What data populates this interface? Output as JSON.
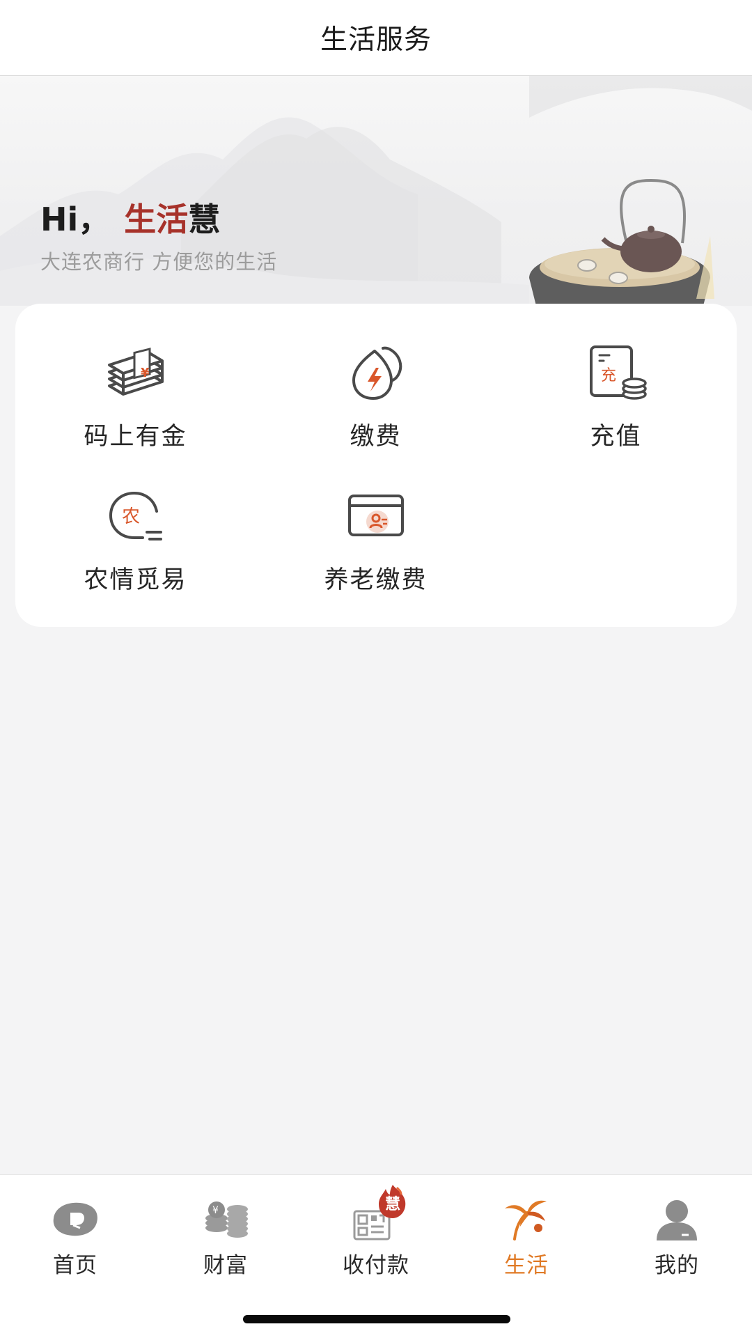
{
  "header": {
    "title": "生活服务"
  },
  "banner": {
    "greeting_prefix": "Hi",
    "greeting_comma": "，",
    "greeting_accent": "生活",
    "greeting_suffix": "慧",
    "subtitle": "大连农商行 方便您的生活"
  },
  "services": [
    {
      "label": "码上有金",
      "icon": "money-stack-icon"
    },
    {
      "label": "缴费",
      "icon": "utility-payment-icon"
    },
    {
      "label": "充值",
      "icon": "recharge-icon"
    },
    {
      "label": "农情觅易",
      "icon": "agriculture-icon"
    },
    {
      "label": "养老缴费",
      "icon": "pension-card-icon"
    }
  ],
  "tabbar": {
    "items": [
      {
        "label": "首页",
        "icon": "home-icon",
        "active": false
      },
      {
        "label": "财富",
        "icon": "wealth-coins-icon",
        "active": false
      },
      {
        "label": "收付款",
        "icon": "qr-payment-icon",
        "active": false,
        "badge": "慧"
      },
      {
        "label": "生活",
        "icon": "life-palm-icon",
        "active": true
      },
      {
        "label": "我的",
        "icon": "profile-icon",
        "active": false
      }
    ]
  },
  "colors": {
    "accent_red": "#a7322a",
    "icon_accent": "#d9572b",
    "active_tab": "#e07a26",
    "icon_stroke": "#4a4a4a"
  }
}
